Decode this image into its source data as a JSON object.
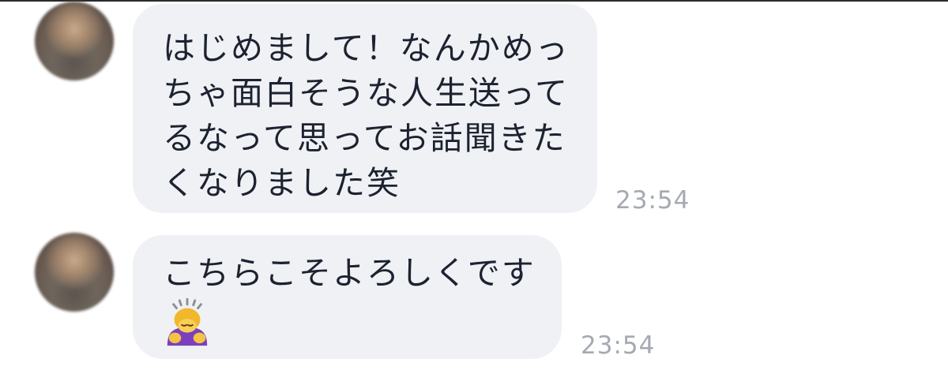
{
  "messages": [
    {
      "lines": [
        "はじめまして！なんかめっ",
        "ちゃ面白そうな人生送って",
        "るなって思ってお話聞きた",
        "くなりました笑"
      ],
      "time": "23:54"
    },
    {
      "lines": [
        "こちらこそよろしくです"
      ],
      "emoji": "person-bowing-icon",
      "time": "23:54"
    }
  ],
  "colors": {
    "bubble_bg": "#eff1f4",
    "text": "#1c2230",
    "timestamp": "#a4a9b2"
  }
}
